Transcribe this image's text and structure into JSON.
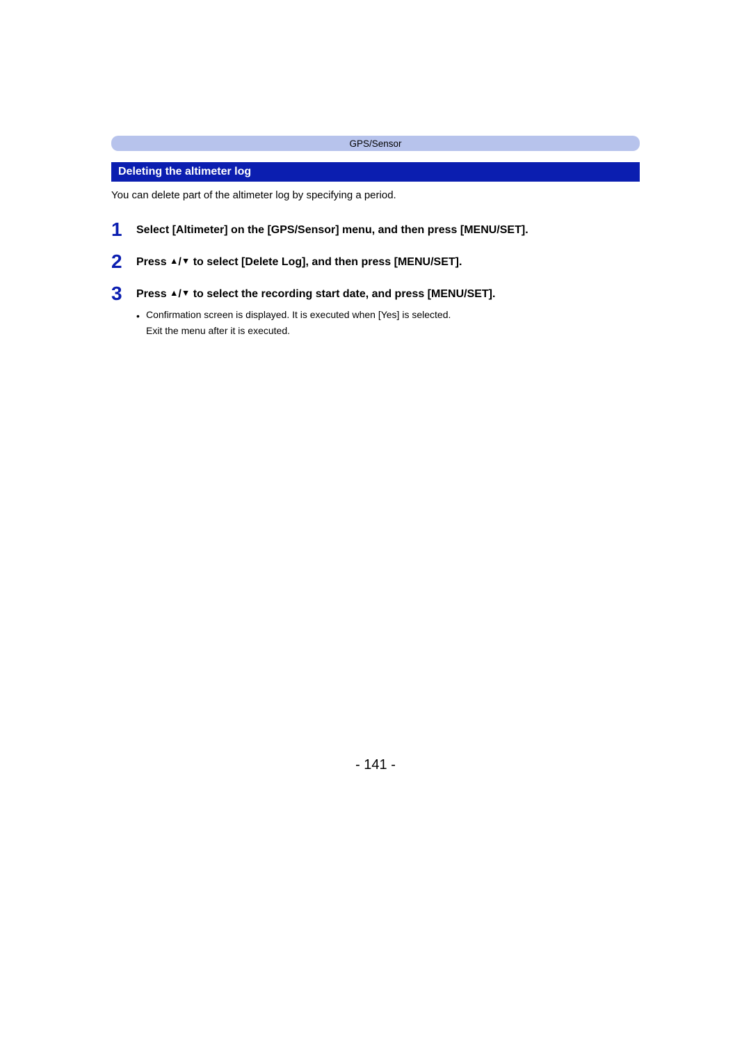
{
  "breadcrumb": "GPS/Sensor",
  "section_title": "Deleting the altimeter log",
  "intro": "You can delete part of the altimeter log by specifying a period.",
  "steps": {
    "s1": {
      "num": "1",
      "text": "Select [Altimeter] on the [GPS/Sensor] menu, and then press [MENU/SET]."
    },
    "s2": {
      "num": "2",
      "t_before": "Press ",
      "t_after": " to select [Delete Log], and then press [MENU/SET]."
    },
    "s3": {
      "num": "3",
      "t_before": "Press ",
      "t_after": " to select the recording start date, and press [MENU/SET].",
      "note1": "Confirmation screen is displayed. It is executed when [Yes] is selected.",
      "note2": "Exit the menu after it is executed."
    }
  },
  "page_number": "- 141 -"
}
